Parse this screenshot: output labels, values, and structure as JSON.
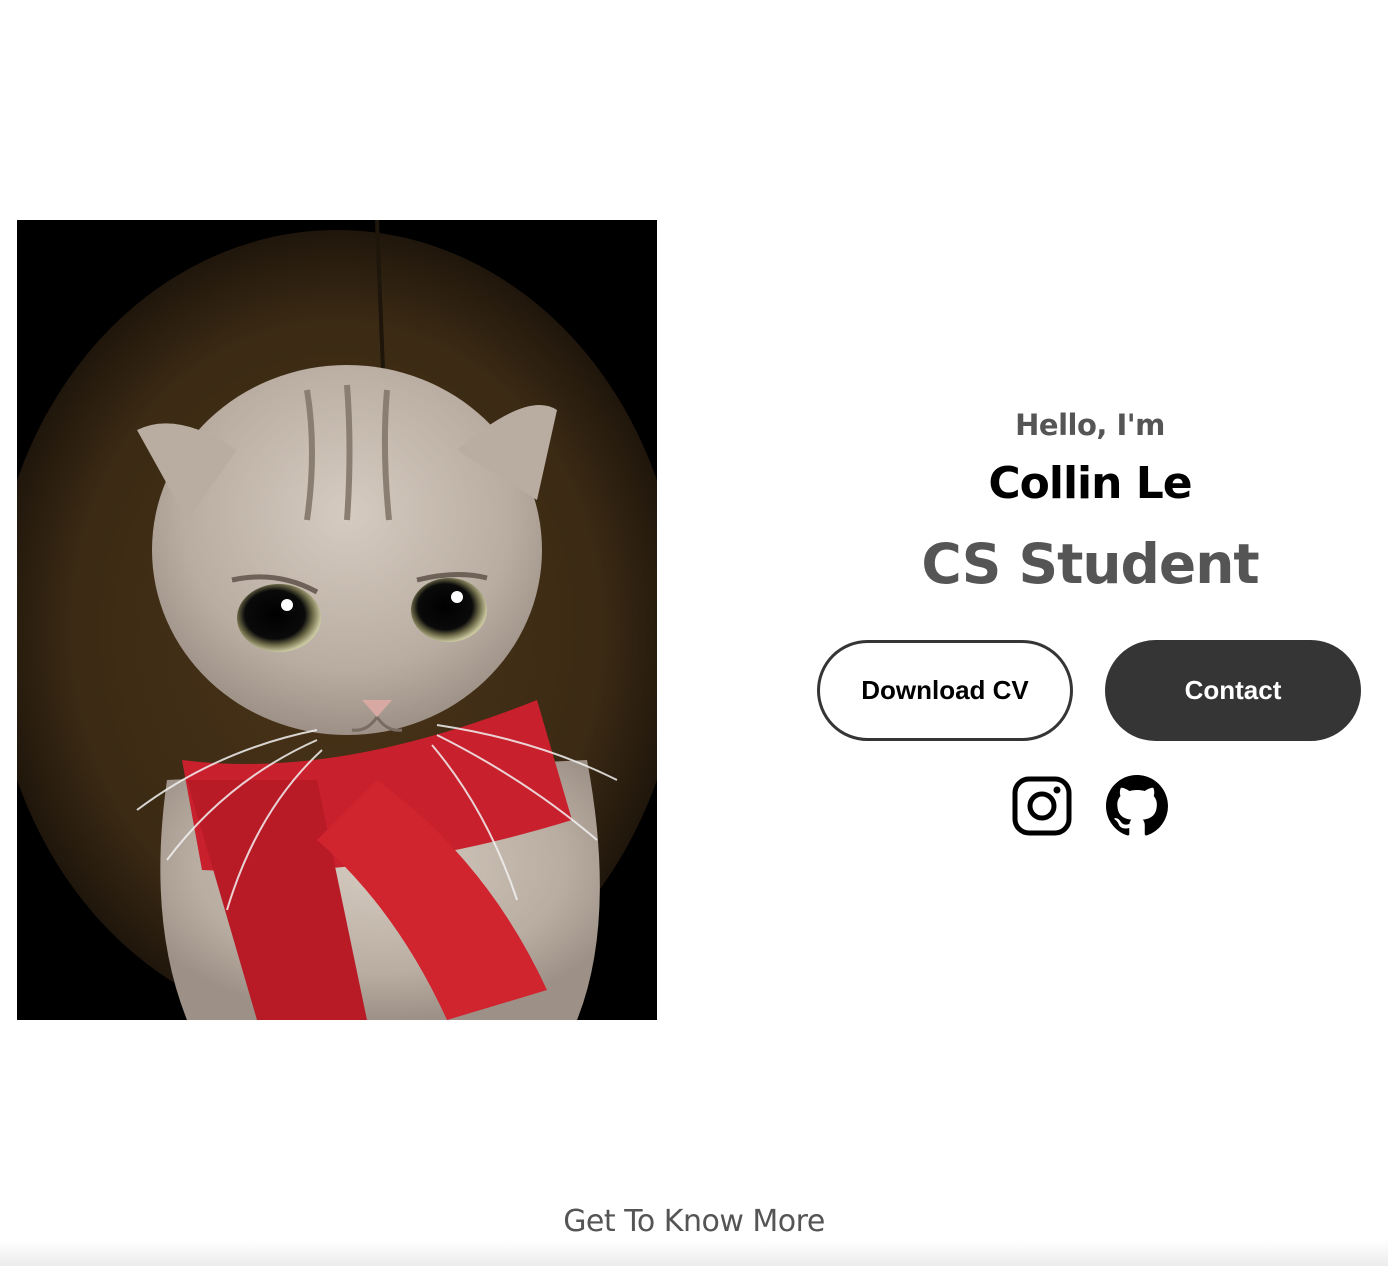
{
  "profile": {
    "image_alt": "Cat wearing a red scarf"
  },
  "intro": {
    "greeting": "Hello, I'm",
    "name": "Collin Le",
    "role": "CS Student"
  },
  "buttons": {
    "download_label": "Download CV",
    "contact_label": "Contact"
  },
  "socials": [
    {
      "icon": "instagram-icon"
    },
    {
      "icon": "github-icon"
    }
  ],
  "footer": {
    "know_more": "Get To Know More"
  },
  "colors": {
    "primary_dark": "#353535",
    "secondary_text": "#555555",
    "text": "#000000",
    "background": "#ffffff"
  }
}
